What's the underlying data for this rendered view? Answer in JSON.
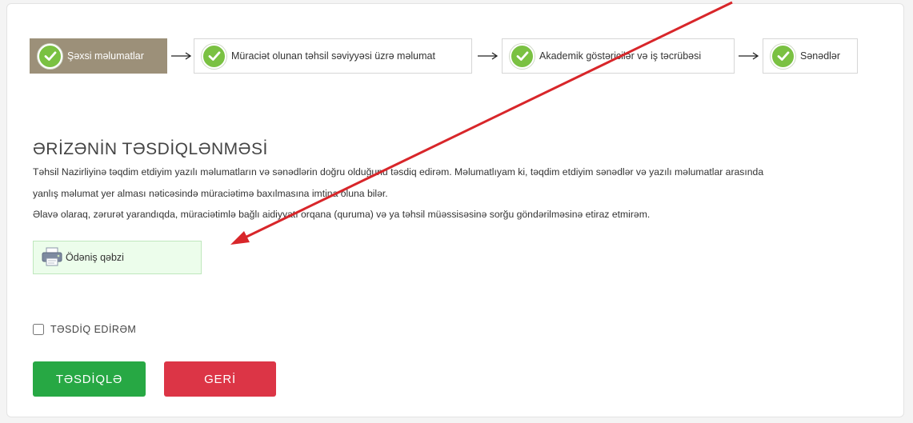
{
  "stepper": {
    "steps": [
      {
        "label": "Şəxsi məlumatlar",
        "active": true
      },
      {
        "label": "Müraciət olunan təhsil səviyyəsi üzrə məlumat",
        "active": false
      },
      {
        "label": "Akademik göstəricilər və iş təcrübəsi",
        "active": false
      },
      {
        "label": "Sənədlər",
        "active": false
      }
    ],
    "check_icon": "check-circle-icon",
    "arrow_icon": "arrow-right-icon"
  },
  "main": {
    "title": "ƏRİZƏNİN TƏSDİQLƏNMƏSİ",
    "paragraphs": [
      "Təhsil Nazirliyinə təqdim etdiyim yazılı məlumatların və sənədlərin doğru olduğunu təsdiq edirəm. Məlumatlıyam ki, təqdim etdiyim sənədlər və yazılı məlumatlar arasında",
      "yanlış məlumat yer alması nəticəsində müraciətimə baxılmasına imtina oluna bilər.",
      "Əlavə olaraq, zərurət yarandıqda, müraciətimlə bağlı aidiyyatı orqana (quruma) və ya təhsil müəssisəsinə sorğu göndərilməsinə etiraz etmirəm."
    ],
    "receipt_label": "Ödəniş qəbzi",
    "receipt_icon": "printer-icon",
    "confirm_label": "TƏSDİQ EDİRƏM",
    "confirm_checked": false,
    "submit_label": "TƏSDİQLƏ",
    "back_label": "GERİ"
  },
  "colors": {
    "active_step": "#9c9079",
    "check_green": "#7ac142",
    "receipt_bg": "#ecfdeb",
    "submit_green": "#27a844",
    "back_red": "#dc3546",
    "annotation_arrow": "#d8262a"
  }
}
